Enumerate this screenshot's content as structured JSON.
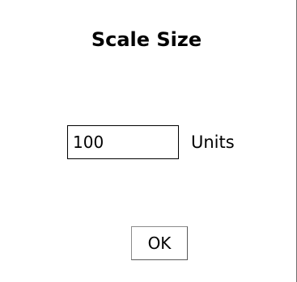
{
  "dialog": {
    "title": "Scale Size",
    "size_field": {
      "value": "100",
      "placeholder": ""
    },
    "units_label": "Units",
    "ok_label": "OK"
  }
}
